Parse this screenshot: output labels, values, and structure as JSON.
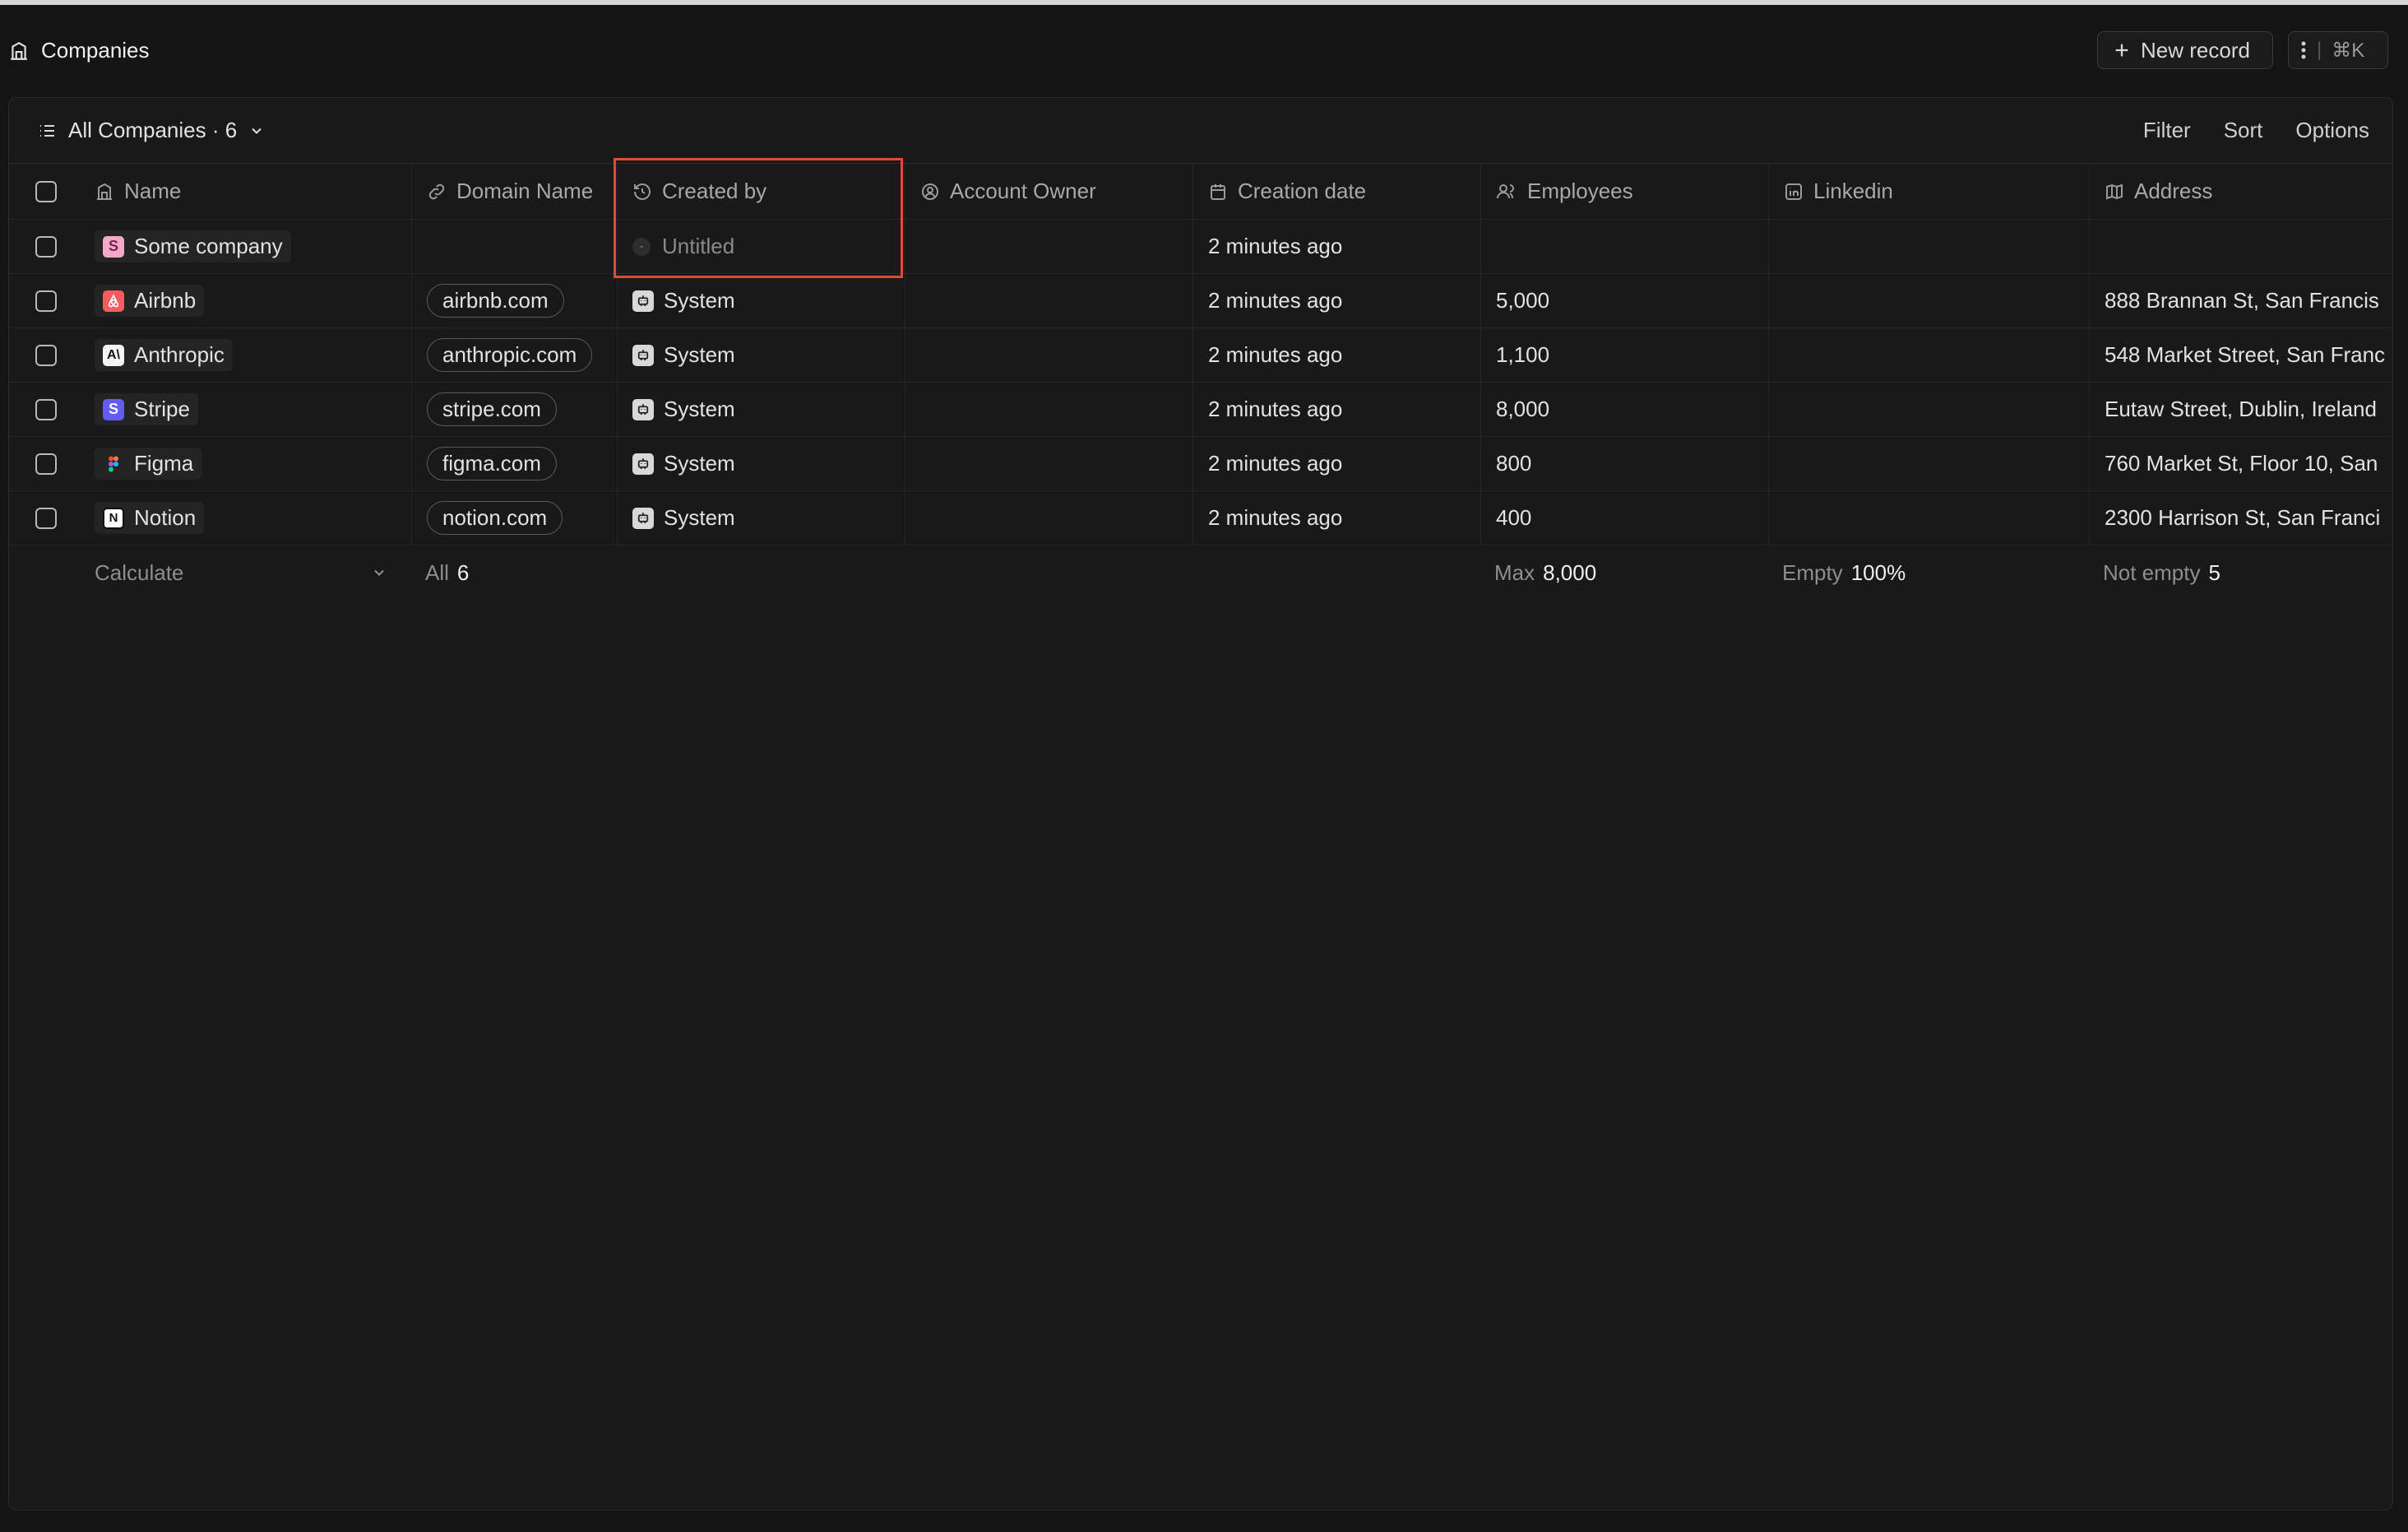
{
  "header": {
    "title": "Companies",
    "new_record_label": "New record",
    "shortcut_label": "⌘K"
  },
  "view": {
    "name": "All Companies · 6",
    "actions": {
      "filter": "Filter",
      "sort": "Sort",
      "options": "Options"
    }
  },
  "columns": [
    {
      "label": "Name",
      "icon": "building-icon"
    },
    {
      "label": "Domain Name",
      "icon": "link-icon"
    },
    {
      "label": "Created by",
      "icon": "history-icon"
    },
    {
      "label": "Account Owner",
      "icon": "user-circle-icon"
    },
    {
      "label": "Creation date",
      "icon": "calendar-icon"
    },
    {
      "label": "Employees",
      "icon": "users-icon"
    },
    {
      "label": "Linkedin",
      "icon": "linkedin-icon"
    },
    {
      "label": "Address",
      "icon": "map-icon"
    }
  ],
  "rows": [
    {
      "name": "Some company",
      "logo_letter": "S",
      "logo_color": "#f3a9c9",
      "domain": "",
      "created_by": "Untitled",
      "created_by_empty_mark": "-",
      "account_owner": "",
      "creation_date": "2 minutes ago",
      "employees": "",
      "linkedin": "",
      "address": ""
    },
    {
      "name": "Airbnb",
      "logo_letter": "A",
      "logo_color": "#ff5a5f",
      "domain": "airbnb.com",
      "created_by": "System",
      "account_owner": "",
      "creation_date": "2 minutes ago",
      "employees": "5,000",
      "linkedin": "",
      "address": "888 Brannan St, San Francis"
    },
    {
      "name": "Anthropic",
      "logo_letter": "A\\",
      "logo_color": "#f5f5f5",
      "domain": "anthropic.com",
      "created_by": "System",
      "account_owner": "",
      "creation_date": "2 minutes ago",
      "employees": "1,100",
      "linkedin": "",
      "address": "548 Market Street, San Franc"
    },
    {
      "name": "Stripe",
      "logo_letter": "S",
      "logo_color": "#635bff",
      "domain": "stripe.com",
      "created_by": "System",
      "account_owner": "",
      "creation_date": "2 minutes ago",
      "employees": "8,000",
      "linkedin": "",
      "address": "Eutaw Street, Dublin, Ireland"
    },
    {
      "name": "Figma",
      "logo_letter": "F",
      "logo_color": "#242424",
      "domain": "figma.com",
      "created_by": "System",
      "account_owner": "",
      "creation_date": "2 minutes ago",
      "employees": "800",
      "linkedin": "",
      "address": "760 Market St, Floor 10, San"
    },
    {
      "name": "Notion",
      "logo_letter": "N",
      "logo_color": "#ffffff",
      "domain": "notion.com",
      "created_by": "System",
      "account_owner": "",
      "creation_date": "2 minutes ago",
      "employees": "400",
      "linkedin": "",
      "address": "2300 Harrison St, San Franci"
    }
  ],
  "footer": {
    "calculate": "Calculate",
    "domain_agg_label": "All",
    "domain_agg_value": "6",
    "employees_agg_label": "Max",
    "employees_agg_value": "8,000",
    "linkedin_agg_label": "Empty",
    "linkedin_agg_value": "100%",
    "address_agg_label": "Not empty",
    "address_agg_value": "5"
  },
  "colors": {
    "background": "#141414",
    "panel": "#191919",
    "highlight": "#e04a36"
  }
}
